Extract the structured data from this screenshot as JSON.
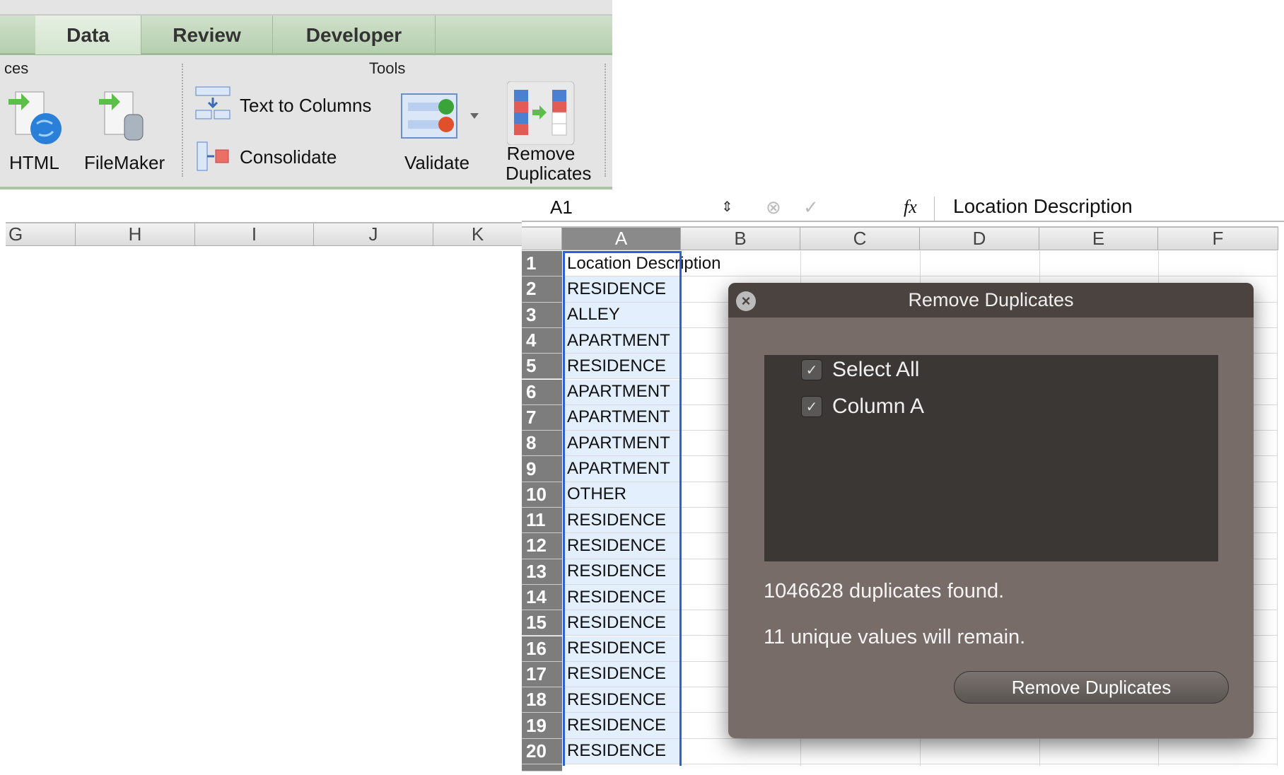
{
  "ribbon": {
    "tabs": [
      {
        "label": "Data",
        "active": true
      },
      {
        "label": "Review"
      },
      {
        "label": "Developer"
      }
    ],
    "groups": {
      "sources_partial": "ces",
      "tools": "Tools"
    },
    "buttons": {
      "html": "HTML",
      "filemaker": "FileMaker",
      "text_to_columns": "Text to Columns",
      "consolidate": "Consolidate",
      "validate": "Validate",
      "remove_duplicates_line1": "Remove",
      "remove_duplicates_line2": "Duplicates"
    }
  },
  "left_sheet": {
    "columns": [
      "G",
      "H",
      "I",
      "J",
      "K"
    ]
  },
  "formula_bar": {
    "cell_ref": "A1",
    "fx": "fx",
    "value": "Location Description"
  },
  "sheet": {
    "columns": [
      "A",
      "B",
      "C",
      "D",
      "E",
      "F"
    ],
    "rows": [
      {
        "n": "1",
        "a": "Location Description"
      },
      {
        "n": "2",
        "a": "RESIDENCE"
      },
      {
        "n": "3",
        "a": "ALLEY"
      },
      {
        "n": "4",
        "a": "APARTMENT"
      },
      {
        "n": "5",
        "a": "RESIDENCE"
      },
      {
        "n": "6",
        "a": "APARTMENT"
      },
      {
        "n": "7",
        "a": "APARTMENT"
      },
      {
        "n": "8",
        "a": "APARTMENT"
      },
      {
        "n": "9",
        "a": "APARTMENT"
      },
      {
        "n": "10",
        "a": "OTHER"
      },
      {
        "n": "11",
        "a": "RESIDENCE"
      },
      {
        "n": "12",
        "a": "RESIDENCE"
      },
      {
        "n": "13",
        "a": "RESIDENCE"
      },
      {
        "n": "14",
        "a": "RESIDENCE"
      },
      {
        "n": "15",
        "a": "RESIDENCE"
      },
      {
        "n": "16",
        "a": "RESIDENCE"
      },
      {
        "n": "17",
        "a": "RESIDENCE"
      },
      {
        "n": "18",
        "a": "RESIDENCE"
      },
      {
        "n": "19",
        "a": "RESIDENCE"
      },
      {
        "n": "20",
        "a": "RESIDENCE"
      }
    ]
  },
  "dialog": {
    "title": "Remove Duplicates",
    "options": [
      {
        "label": "Select All",
        "checked": true
      },
      {
        "label": "Column A",
        "checked": true
      }
    ],
    "duplicates_text": "1046628 duplicates found.",
    "unique_text": "11 unique values will remain.",
    "button": "Remove Duplicates"
  }
}
